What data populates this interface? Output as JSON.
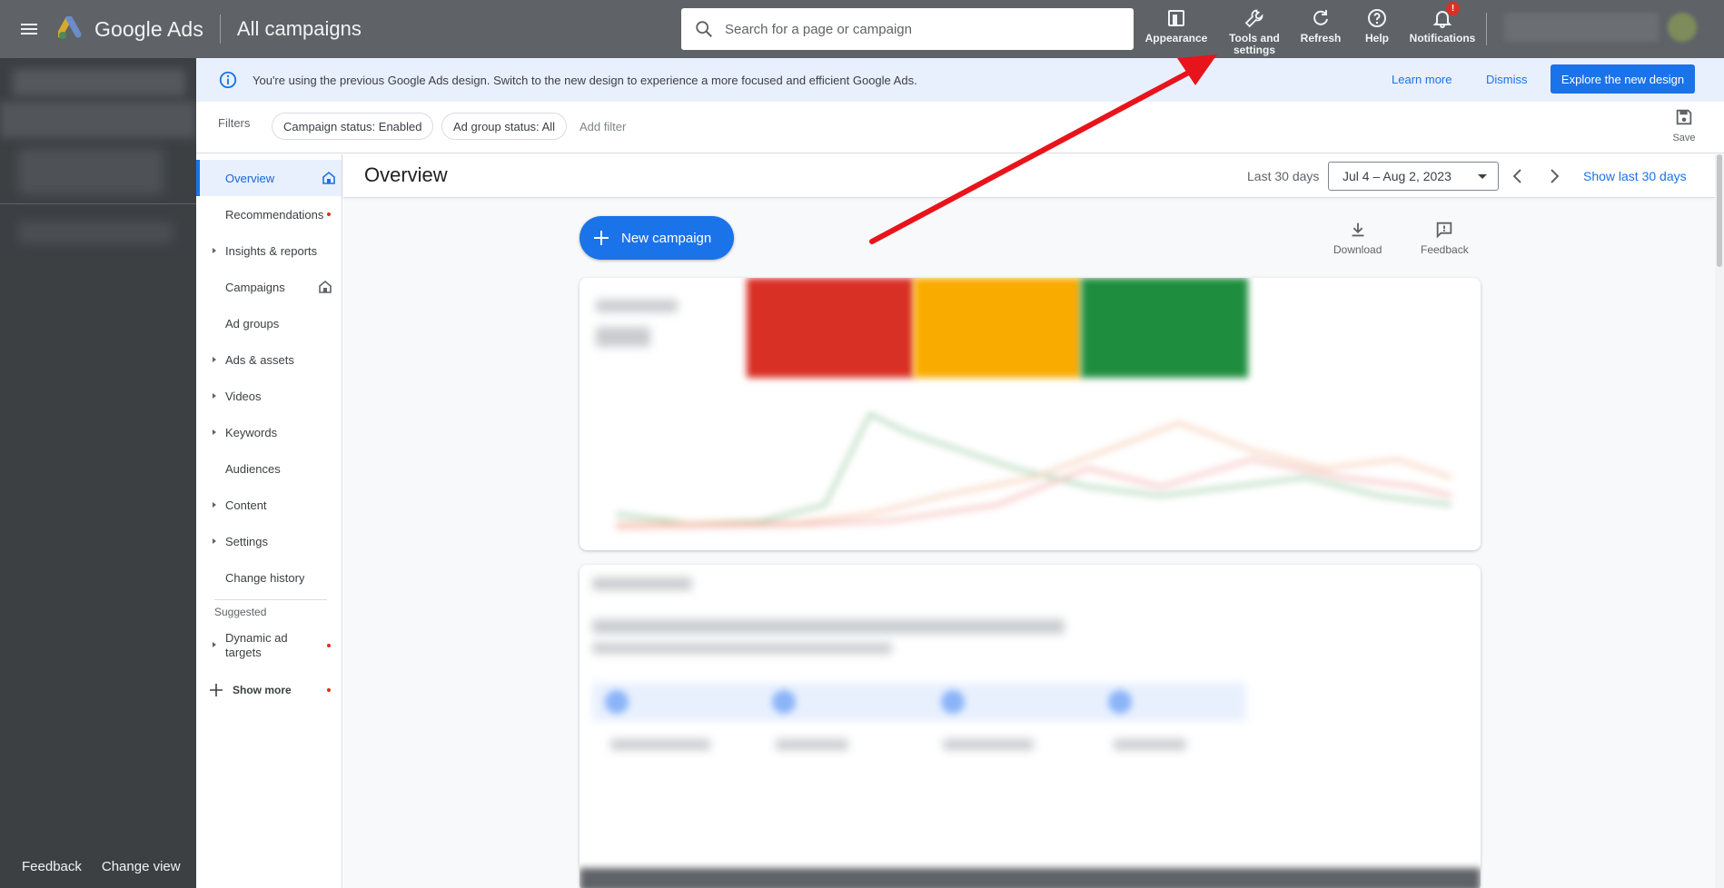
{
  "header": {
    "logo_text": "Google Ads",
    "page_title": "All campaigns",
    "search_placeholder": "Search for a page or campaign",
    "actions": {
      "appearance": "Appearance",
      "tools_line1": "Tools and",
      "tools_line2": "settings",
      "refresh": "Refresh",
      "help": "Help",
      "notifications": "Notifications",
      "notifications_badge": "!"
    }
  },
  "banner": {
    "text": "You're using the previous Google Ads design. Switch to the new design to experience a more focused and efficient Google Ads.",
    "learn_more": "Learn more",
    "dismiss": "Dismiss",
    "explore": "Explore the new design"
  },
  "filters": {
    "label": "Filters",
    "chips": [
      "Campaign status: Enabled",
      "Ad group status: All"
    ],
    "add_filter": "Add filter",
    "save": "Save"
  },
  "subnav": {
    "items": [
      {
        "label": "Overview",
        "active": true,
        "home": true
      },
      {
        "label": "Recommendations",
        "dot": true
      },
      {
        "label": "Insights & reports",
        "caret": true
      },
      {
        "label": "Campaigns",
        "home": true
      },
      {
        "label": "Ad groups"
      },
      {
        "label": "Ads & assets",
        "caret": true
      },
      {
        "label": "Videos",
        "caret": true
      },
      {
        "label": "Keywords",
        "caret": true
      },
      {
        "label": "Audiences"
      },
      {
        "label": "Content",
        "caret": true
      },
      {
        "label": "Settings",
        "caret": true
      },
      {
        "label": "Change history"
      }
    ],
    "suggested_label": "Suggested",
    "dynamic_ad_targets": "Dynamic ad targets",
    "show_more": "Show more"
  },
  "leftnav": {
    "feedback": "Feedback",
    "change_view": "Change view"
  },
  "main": {
    "title": "Overview",
    "last_days": "Last 30 days",
    "date_range": "Jul 4 – Aug 2, 2023",
    "show_last": "Show last 30 days",
    "new_campaign": "New campaign",
    "download": "Download",
    "feedback": "Feedback"
  },
  "colors": {
    "accent": "#1a73e8",
    "header_bg": "#5f6368",
    "nav_bg": "#3c4043",
    "banner_bg": "#e8f0fe",
    "annotation_arrow": "#e8141b"
  }
}
